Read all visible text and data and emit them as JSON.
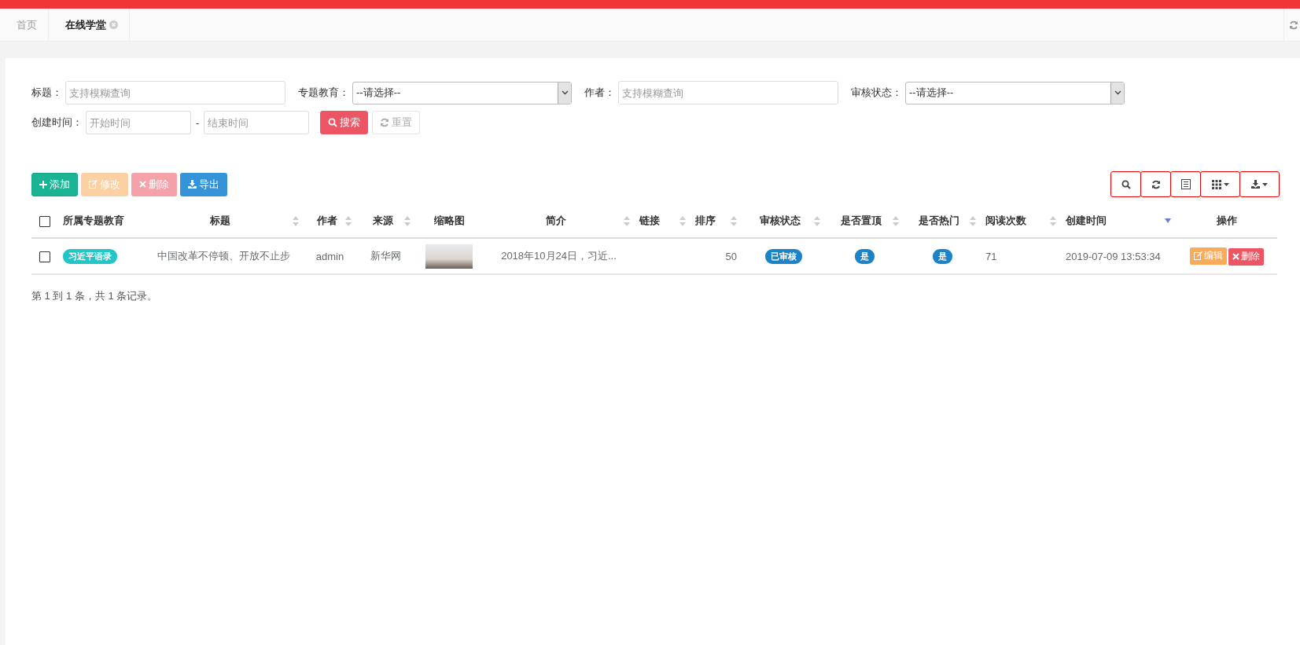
{
  "tabs": [
    {
      "label": "首页",
      "selected": false,
      "closable": false
    },
    {
      "label": "在线学堂",
      "selected": true,
      "closable": true
    }
  ],
  "filters": [
    {
      "label": "标题：",
      "kind": "input",
      "placeholder": "支持模糊查询"
    },
    {
      "label": "专题教育：",
      "kind": "select",
      "value": "--请选择--"
    },
    {
      "label": "作者：",
      "kind": "input",
      "placeholder": "支持模糊查询"
    },
    {
      "label": "审核状态：",
      "kind": "select",
      "value": "--请选择--"
    }
  ],
  "date_range": {
    "label": "创建时间：",
    "start_placeholder": "开始时间",
    "separator": "-",
    "end_placeholder": "结束时间"
  },
  "search_buttons": [
    {
      "label": "搜索",
      "kind": "search"
    },
    {
      "label": "重置",
      "kind": "reset"
    }
  ],
  "toolbar": [
    {
      "label": "添加",
      "kind": "add",
      "disabled": false
    },
    {
      "label": "修改",
      "kind": "edit",
      "disabled": true
    },
    {
      "label": "删除",
      "kind": "delete",
      "disabled": true
    },
    {
      "label": "导出",
      "kind": "export",
      "disabled": false
    }
  ],
  "table_tools": [
    {
      "kind": "search"
    },
    {
      "kind": "refresh"
    },
    {
      "kind": "list"
    },
    {
      "kind": "columns"
    },
    {
      "kind": "export"
    }
  ],
  "table": {
    "select_all_checked": false,
    "columns": [
      {
        "label": "所属专题教育",
        "sortable": false
      },
      {
        "label": "标题",
        "sortable": true,
        "sorted": false
      },
      {
        "label": "作者",
        "sortable": true,
        "sorted": false
      },
      {
        "label": "来源",
        "sortable": true,
        "sorted": false
      },
      {
        "label": "缩略图",
        "sortable": false
      },
      {
        "label": "简介",
        "sortable": true,
        "sorted": false
      },
      {
        "label": "链接",
        "sortable": true,
        "sorted": false
      },
      {
        "label": "排序",
        "sortable": true,
        "sorted": false
      },
      {
        "label": "审核状态",
        "sortable": true,
        "sorted": false
      },
      {
        "label": "是否置顶",
        "sortable": true,
        "sorted": false
      },
      {
        "label": "是否热门",
        "sortable": true,
        "sorted": false
      },
      {
        "label": "阅读次数",
        "sortable": true,
        "sorted": false
      },
      {
        "label": "创建时间",
        "sortable": true,
        "sorted": true
      },
      {
        "label": "操作",
        "sortable": false
      }
    ],
    "rows": [
      {
        "checked": false,
        "cells": [
          {
            "kind": "tag",
            "text": "习近平语录"
          },
          {
            "kind": "text",
            "text": "中国改革不停顿、开放不止步"
          },
          {
            "kind": "text",
            "text": "admin"
          },
          {
            "kind": "text",
            "text": "新华网"
          },
          {
            "kind": "image"
          },
          {
            "kind": "text",
            "text": "2018年10月24日，习近..."
          },
          null,
          {
            "kind": "text",
            "text": "50"
          },
          {
            "kind": "badge",
            "text": "已审核"
          },
          {
            "kind": "badge",
            "text": "是"
          },
          {
            "kind": "badge",
            "text": "是"
          },
          {
            "kind": "text",
            "text": "71"
          },
          {
            "kind": "text",
            "text": "2019-07-09 13:53:34"
          },
          {
            "kind": "actions",
            "buttons": [
              {
                "label": "编辑",
                "kind": "edit"
              },
              {
                "label": "删除",
                "kind": "delete"
              }
            ]
          }
        ]
      }
    ]
  },
  "pagination_info": "第 1 到 1 条，共 1 条记录。"
}
